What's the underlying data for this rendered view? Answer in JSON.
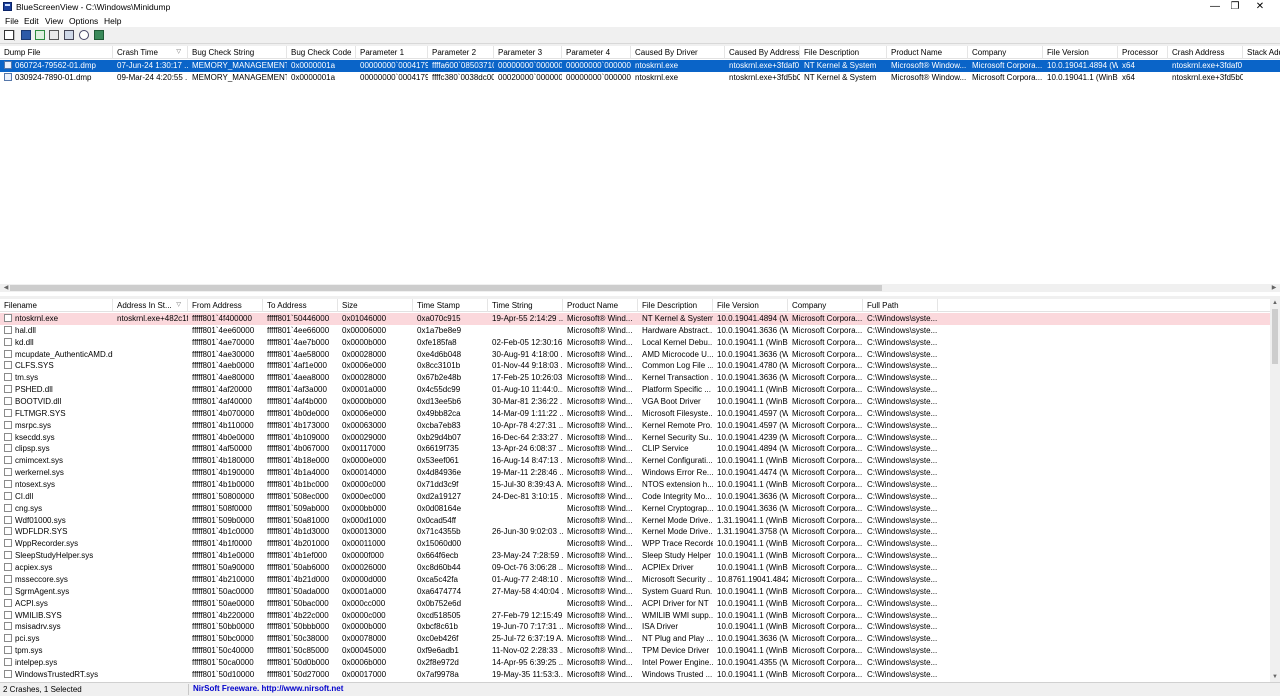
{
  "window": {
    "title": "BlueScreenView - C:\\Windows\\Minidump",
    "minimize": "—",
    "maximize": "❐",
    "close": "✕"
  },
  "menu": [
    "File",
    "Edit",
    "View",
    "Options",
    "Help"
  ],
  "toolbar": {
    "icons": [
      "properties-icon",
      "save-icon",
      "html-report-icon",
      "copy-icon",
      "advanced-options-icon",
      "find-icon",
      "exit-icon"
    ]
  },
  "crashes": {
    "columns": [
      "Dump File",
      "Crash Time",
      "Bug Check String",
      "Bug Check Code",
      "Parameter 1",
      "Parameter 2",
      "Parameter 3",
      "Parameter 4",
      "Caused By Driver",
      "Caused By Address",
      "File Description",
      "Product Name",
      "Company",
      "File Version",
      "Processor",
      "Crash Address",
      "Stack Add"
    ],
    "rows": [
      [
        "060724-79562-01.dmp",
        "07-Jun-24 1:30:17 ...",
        "MEMORY_MANAGEMENT",
        "0x0000001a",
        "00000000`00041790",
        "ffffa600`08503710",
        "00000000`000000...",
        "00000000`000000...",
        "ntoskrnl.exe",
        "ntoskrnl.exe+3fdaf0",
        "NT Kernel & System",
        "Microsoft® Window...",
        "Microsoft Corpora...",
        "10.0.19041.4894 (W...",
        "x64",
        "ntoskrnl.exe+3fdaf0",
        ""
      ],
      [
        "030924-7890-01.dmp",
        "09-Mar-24 4:20:55 ...",
        "MEMORY_MANAGEMENT",
        "0x0000001a",
        "00000000`00041792",
        "ffffc380`0038dc00",
        "00020000`000000...",
        "00000000`000000...",
        "ntoskrnl.exe",
        "ntoskrnl.exe+3fd5b0",
        "NT Kernel & System",
        "Microsoft® Window...",
        "Microsoft Corpora...",
        "10.0.19041.1 (WinB...",
        "x64",
        "ntoskrnl.exe+3fd5b0",
        ""
      ]
    ]
  },
  "modules": {
    "columns": [
      "Filename",
      "Address In St...",
      "From Address",
      "To Address",
      "Size",
      "Time Stamp",
      "Time String",
      "Product Name",
      "File Description",
      "File Version",
      "Company",
      "Full Path"
    ],
    "rows": [
      [
        "ntoskrnl.exe",
        "ntoskrnl.exe+482c1f",
        "fffff801`4f400000",
        "fffff801`50446000",
        "0x01046000",
        "0xa070c915",
        "19-Apr-55 2:14:29 ...",
        "Microsoft® Wind...",
        "NT Kernel & System",
        "10.0.19041.4894 (W...",
        "Microsoft Corpora...",
        "C:\\Windows\\syste..."
      ],
      [
        "hal.dll",
        "",
        "fffff801`4ee60000",
        "fffff801`4ee66000",
        "0x00006000",
        "0x1a7be8e9",
        "",
        "Microsoft® Wind...",
        "Hardware Abstract...",
        "10.0.19041.3636 (W...",
        "Microsoft Corpora...",
        "C:\\Windows\\syste..."
      ],
      [
        "kd.dll",
        "",
        "fffff801`4ae70000",
        "fffff801`4ae7b000",
        "0x0000b000",
        "0xfe185fa8",
        "02-Feb-05 12:30:16...",
        "Microsoft® Wind...",
        "Local Kernel Debu...",
        "10.0.19041.1 (WinB...",
        "Microsoft Corpora...",
        "C:\\Windows\\syste..."
      ],
      [
        "mcupdate_AuthenticAMD.dll",
        "",
        "fffff801`4ae30000",
        "fffff801`4ae58000",
        "0x00028000",
        "0xe4d6b048",
        "30-Aug-91 4:18:00 ...",
        "Microsoft® Wind...",
        "AMD Microcode U...",
        "10.0.19041.3636 (W...",
        "Microsoft Corpora...",
        "C:\\Windows\\syste..."
      ],
      [
        "CLFS.SYS",
        "",
        "fffff801`4aeb0000",
        "fffff801`4af1e000",
        "0x0006e000",
        "0x8cc3101b",
        "01-Nov-44 9:18:03 ...",
        "Microsoft® Wind...",
        "Common Log File ...",
        "10.0.19041.4780 (W...",
        "Microsoft Corpora...",
        "C:\\Windows\\syste..."
      ],
      [
        "tm.sys",
        "",
        "fffff801`4ae80000",
        "fffff801`4aea8000",
        "0x00028000",
        "0x67b2e48b",
        "17-Feb-25 10:26:03...",
        "Microsoft® Wind...",
        "Kernel Transaction ...",
        "10.0.19041.3636 (W...",
        "Microsoft Corpora...",
        "C:\\Windows\\syste..."
      ],
      [
        "PSHED.dll",
        "",
        "fffff801`4af20000",
        "fffff801`4af3a000",
        "0x0001a000",
        "0x4c55dc99",
        "01-Aug-10 11:44:0...",
        "Microsoft® Wind...",
        "Platform Specific ...",
        "10.0.19041.1 (WinB...",
        "Microsoft Corpora...",
        "C:\\Windows\\syste..."
      ],
      [
        "BOOTVID.dll",
        "",
        "fffff801`4af40000",
        "fffff801`4af4b000",
        "0x0000b000",
        "0xd13ee5b6",
        "30-Mar-81 2:36:22 ...",
        "Microsoft® Wind...",
        "VGA Boot Driver",
        "10.0.19041.1 (WinB...",
        "Microsoft Corpora...",
        "C:\\Windows\\syste..."
      ],
      [
        "FLTMGR.SYS",
        "",
        "fffff801`4b070000",
        "fffff801`4b0de000",
        "0x0006e000",
        "0x49bb82ca",
        "14-Mar-09 1:11:22 ...",
        "Microsoft® Wind...",
        "Microsoft Filesyste...",
        "10.0.19041.4597 (W...",
        "Microsoft Corpora...",
        "C:\\Windows\\syste..."
      ],
      [
        "msrpc.sys",
        "",
        "fffff801`4b110000",
        "fffff801`4b173000",
        "0x00063000",
        "0xcba7eb83",
        "10-Apr-78 4:27:31 ...",
        "Microsoft® Wind...",
        "Kernel Remote Pro...",
        "10.0.19041.4597 (W...",
        "Microsoft Corpora...",
        "C:\\Windows\\syste..."
      ],
      [
        "ksecdd.sys",
        "",
        "fffff801`4b0e0000",
        "fffff801`4b109000",
        "0x00029000",
        "0xb29d4b07",
        "16-Dec-64 2:33:27 ...",
        "Microsoft® Wind...",
        "Kernel Security Su...",
        "10.0.19041.4239 (W...",
        "Microsoft Corpora...",
        "C:\\Windows\\syste..."
      ],
      [
        "clipsp.sys",
        "",
        "fffff801`4af50000",
        "fffff801`4b067000",
        "0x00117000",
        "0x6619f735",
        "13-Apr-24 6:08:37 ...",
        "Microsoft® Wind...",
        "CLIP Service",
        "10.0.19041.4894 (W...",
        "Microsoft Corpora...",
        "C:\\Windows\\syste..."
      ],
      [
        "cmimcext.sys",
        "",
        "fffff801`4b180000",
        "fffff801`4b18e000",
        "0x0000e000",
        "0x53eef061",
        "16-Aug-14 8:47:13 ...",
        "Microsoft® Wind...",
        "Kernel Configurati...",
        "10.0.19041.1 (WinB...",
        "Microsoft Corpora...",
        "C:\\Windows\\syste..."
      ],
      [
        "werkernel.sys",
        "",
        "fffff801`4b190000",
        "fffff801`4b1a4000",
        "0x00014000",
        "0x4d84936e",
        "19-Mar-11 2:28:46 ...",
        "Microsoft® Wind...",
        "Windows Error Re...",
        "10.0.19041.4474 (W...",
        "Microsoft Corpora...",
        "C:\\Windows\\syste..."
      ],
      [
        "ntosext.sys",
        "",
        "fffff801`4b1b0000",
        "fffff801`4b1bc000",
        "0x0000c000",
        "0x71dd3c9f",
        "15-Jul-30 8:39:43 A...",
        "Microsoft® Wind...",
        "NTOS extension h...",
        "10.0.19041.1 (WinB...",
        "Microsoft Corpora...",
        "C:\\Windows\\syste..."
      ],
      [
        "CI.dll",
        "",
        "fffff801`50800000",
        "fffff801`508ec000",
        "0x000ec000",
        "0xd2a19127",
        "24-Dec-81 3:10:15 ...",
        "Microsoft® Wind...",
        "Code Integrity Mo...",
        "10.0.19041.3636 (W...",
        "Microsoft Corpora...",
        "C:\\Windows\\syste..."
      ],
      [
        "cng.sys",
        "",
        "fffff801`508f0000",
        "fffff801`509ab000",
        "0x000bb000",
        "0x0d08164e",
        "",
        "Microsoft® Wind...",
        "Kernel Cryptograp...",
        "10.0.19041.3636 (W...",
        "Microsoft Corpora...",
        "C:\\Windows\\syste..."
      ],
      [
        "Wdf01000.sys",
        "",
        "fffff801`509b0000",
        "fffff801`50a81000",
        "0x000d1000",
        "0x0cad54ff",
        "",
        "Microsoft® Wind...",
        "Kernel Mode Drive...",
        "1.31.19041.1 (WinB...",
        "Microsoft Corpora...",
        "C:\\Windows\\syste..."
      ],
      [
        "WDFLDR.SYS",
        "",
        "fffff801`4b1c0000",
        "fffff801`4b1d3000",
        "0x00013000",
        "0x71c4355b",
        "26-Jun-30 9:02:03 ...",
        "Microsoft® Wind...",
        "Kernel Mode Drive...",
        "1.31.19041.3758 (W...",
        "Microsoft Corpora...",
        "C:\\Windows\\syste..."
      ],
      [
        "WppRecorder.sys",
        "",
        "fffff801`4b1f0000",
        "fffff801`4b201000",
        "0x00011000",
        "0x15060d00",
        "",
        "Microsoft® Wind...",
        "WPP Trace Recorder",
        "10.0.19041.1 (WinB...",
        "Microsoft Corpora...",
        "C:\\Windows\\syste..."
      ],
      [
        "SleepStudyHelper.sys",
        "",
        "fffff801`4b1e0000",
        "fffff801`4b1ef000",
        "0x0000f000",
        "0x664f6ecb",
        "23-May-24 7:28:59 ...",
        "Microsoft® Wind...",
        "Sleep Study Helper",
        "10.0.19041.1 (WinB...",
        "Microsoft Corpora...",
        "C:\\Windows\\syste..."
      ],
      [
        "acpiex.sys",
        "",
        "fffff801`50a90000",
        "fffff801`50ab6000",
        "0x00026000",
        "0xc8d60b44",
        "09-Oct-76 3:06:28 ...",
        "Microsoft® Wind...",
        "ACPIEx Driver",
        "10.0.19041.1 (WinB...",
        "Microsoft Corpora...",
        "C:\\Windows\\syste..."
      ],
      [
        "msseccore.sys",
        "",
        "fffff801`4b210000",
        "fffff801`4b21d000",
        "0x0000d000",
        "0xca5c42fa",
        "01-Aug-77 2:48:10 ...",
        "Microsoft® Wind...",
        "Microsoft Security ...",
        "10.8761.19041.4842...",
        "Microsoft Corpora...",
        "C:\\Windows\\syste..."
      ],
      [
        "SgrmAgent.sys",
        "",
        "fffff801`50ac0000",
        "fffff801`50ada000",
        "0x0001a000",
        "0xa6474774",
        "27-May-58 4:40:04 ...",
        "Microsoft® Wind...",
        "System Guard Run...",
        "10.0.19041.1 (WinB...",
        "Microsoft Corpora...",
        "C:\\Windows\\syste..."
      ],
      [
        "ACPI.sys",
        "",
        "fffff801`50ae0000",
        "fffff801`50bac000",
        "0x000cc000",
        "0x0b752e6d",
        "",
        "Microsoft® Wind...",
        "ACPI Driver for NT",
        "10.0.19041.1 (WinB...",
        "Microsoft Corpora...",
        "C:\\Windows\\syste..."
      ],
      [
        "WMILIB.SYS",
        "",
        "fffff801`4b220000",
        "fffff801`4b22c000",
        "0x0000c000",
        "0xcd518505",
        "27-Feb-79 12:15:49...",
        "Microsoft® Wind...",
        "WMILIB WMI supp...",
        "10.0.19041.1 (WinB...",
        "Microsoft Corpora...",
        "C:\\Windows\\syste..."
      ],
      [
        "msisadrv.sys",
        "",
        "fffff801`50bb0000",
        "fffff801`50bbb000",
        "0x0000b000",
        "0xbcf8c61b",
        "19-Jun-70 7:17:31 ...",
        "Microsoft® Wind...",
        "ISA Driver",
        "10.0.19041.1 (WinB...",
        "Microsoft Corpora...",
        "C:\\Windows\\syste..."
      ],
      [
        "pci.sys",
        "",
        "fffff801`50bc0000",
        "fffff801`50c38000",
        "0x00078000",
        "0xc0eb426f",
        "25-Jul-72 6:37:19 A...",
        "Microsoft® Wind...",
        "NT Plug and Play ...",
        "10.0.19041.3636 (W...",
        "Microsoft Corpora...",
        "C:\\Windows\\syste..."
      ],
      [
        "tpm.sys",
        "",
        "fffff801`50c40000",
        "fffff801`50c85000",
        "0x00045000",
        "0xf9e6adb1",
        "11-Nov-02 2:28:33 ...",
        "Microsoft® Wind...",
        "TPM Device Driver",
        "10.0.19041.1 (WinB...",
        "Microsoft Corpora...",
        "C:\\Windows\\syste..."
      ],
      [
        "intelpep.sys",
        "",
        "fffff801`50ca0000",
        "fffff801`50d0b000",
        "0x0006b000",
        "0x2f8e972d",
        "14-Apr-95 6:39:25 ...",
        "Microsoft® Wind...",
        "Intel Power Engine...",
        "10.0.19041.4355 (W...",
        "Microsoft Corpora...",
        "C:\\Windows\\syste..."
      ],
      [
        "WindowsTrustedRT.sys",
        "",
        "fffff801`50d10000",
        "fffff801`50d27000",
        "0x00017000",
        "0x7af9978a",
        "19-May-35 11:53:3...",
        "Microsoft® Wind...",
        "Windows Trusted ...",
        "10.0.19041.1 (WinB...",
        "Microsoft Corpora...",
        "C:\\Windows\\syste..."
      ]
    ]
  },
  "status": {
    "summary": "2 Crashes, 1 Selected",
    "credit": "NirSoft Freeware.  http://www.nirsoft.net"
  }
}
